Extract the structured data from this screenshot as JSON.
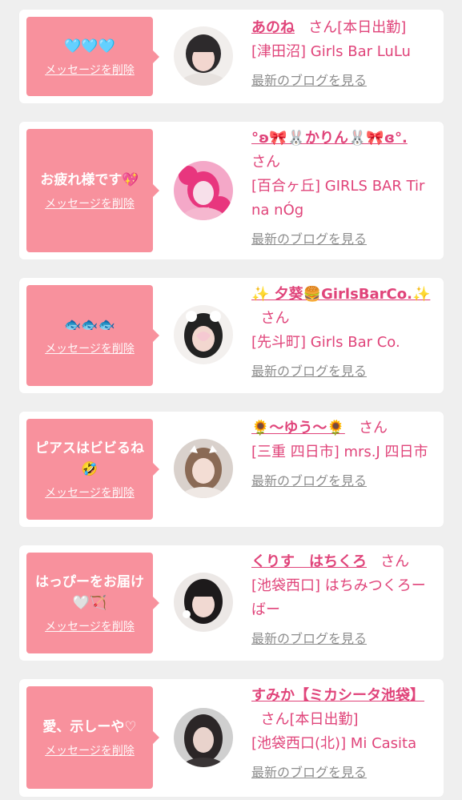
{
  "items": [
    {
      "message": "🩵🩵🩵",
      "delete_label": "メッセージを削除",
      "name": "あのね",
      "suffix": "さん[本日出勤]",
      "shop": "[津田沼] Girls Bar LuLu",
      "blog_label": "最新のブログを見る",
      "avatar_colors": [
        "#f1eeec",
        "#2d2a2c",
        "#f2d6cf"
      ]
    },
    {
      "message": "お疲れ様です💖",
      "delete_label": "メッセージを削除",
      "name": "°ʚ🎀🐰かりん🐰🎀ɞ°.",
      "suffix": "さん",
      "shop": "[百合ヶ丘] GIRLS BAR Tir na nÓg",
      "blog_label": "最新のブログを見る",
      "avatar_colors": [
        "#e8367e",
        "#f4a8c8",
        "#f7e0ea"
      ]
    },
    {
      "message": "🐟🐟🐟",
      "delete_label": "メッセージを削除",
      "name": "✨ 夕葵🍔GirlsBarCo.✨",
      "suffix": "さん",
      "shop": "[先斗町] Girls Bar Co.",
      "blog_label": "最新のブログを見る",
      "avatar_colors": [
        "#f3f0ee",
        "#222222",
        "#f5c9d2"
      ]
    },
    {
      "message": "ピアスはビビるね🤣",
      "delete_label": "メッセージを削除",
      "name": "🌻〜ゆう〜🌻",
      "suffix": "さん",
      "shop": "[三重 四日市] mrs.J 四日市",
      "blog_label": "最新のブログを見る",
      "avatar_colors": [
        "#d9d1cc",
        "#8a6a55",
        "#f3ddd4"
      ]
    },
    {
      "message": "はっぴーをお届け🤍🏹",
      "delete_label": "メッセージを削除",
      "name": "くりす　はちくろ",
      "suffix": "さん",
      "shop": "[池袋西口] はちみつくろーばー",
      "blog_label": "最新のブログを見る",
      "avatar_colors": [
        "#ece8e6",
        "#1d1a1b",
        "#f1d9d2"
      ]
    },
    {
      "message": "愛、示しーや♡",
      "delete_label": "メッセージを削除",
      "name": "すみか【ミカシータ池袋】",
      "suffix": "さん[本日出勤]",
      "shop": "[池袋西口(北)] Mi Casita",
      "blog_label": "最新のブログを見る",
      "avatar_colors": [
        "#cfcfcf",
        "#2b2627",
        "#e9d3cc"
      ]
    }
  ]
}
